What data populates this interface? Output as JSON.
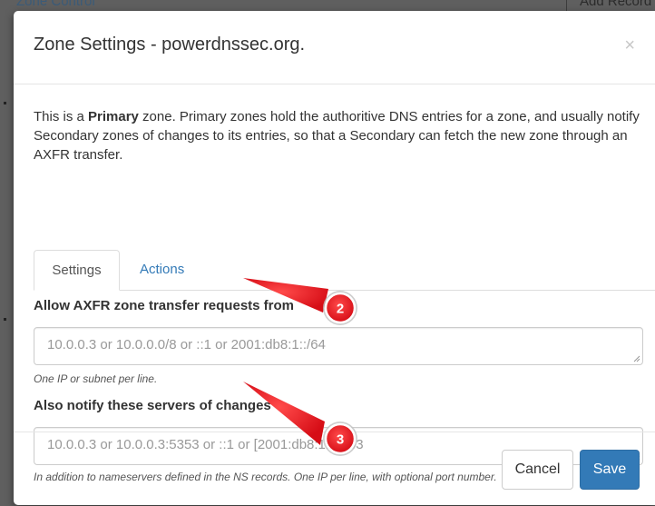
{
  "background": {
    "tab_label": "Zone Control",
    "button_label": "Add Record"
  },
  "modal": {
    "title": "Zone Settings - powerdnssec.org.",
    "close_glyph": "×",
    "intro": {
      "part1": "This is a ",
      "bold": "Primary",
      "part2": " zone. Primary zones hold the authoritive DNS entries for a zone, and usually notify Secondary zones of changes to its entries, so that a Secondary can fetch the new zone through an AXFR transfer."
    },
    "tabs": [
      {
        "label": "Settings",
        "active": true
      },
      {
        "label": "Actions",
        "active": false
      }
    ],
    "axfr": {
      "label": "Allow AXFR zone transfer requests from",
      "placeholder": "10.0.0.3 or 10.0.0.0/8 or ::1 or 2001:db8:1::/64",
      "help": "One IP or subnet per line."
    },
    "notify": {
      "label": "Also notify these servers of changes",
      "placeholder": "10.0.0.3 or 10.0.0.3:5353 or ::1 or [2001:db8:1::1]:53",
      "help": "In addition to nameservers defined in the NS records. One IP per line, with optional port number."
    },
    "footer": {
      "cancel_label": "Cancel",
      "save_label": "Save"
    }
  },
  "annotations": {
    "marker_2": "2",
    "marker_3": "3",
    "color": "#e8141c"
  },
  "colors": {
    "primary": "#337ab7",
    "link": "#337ab7",
    "backdrop": "#5f5f5f"
  }
}
